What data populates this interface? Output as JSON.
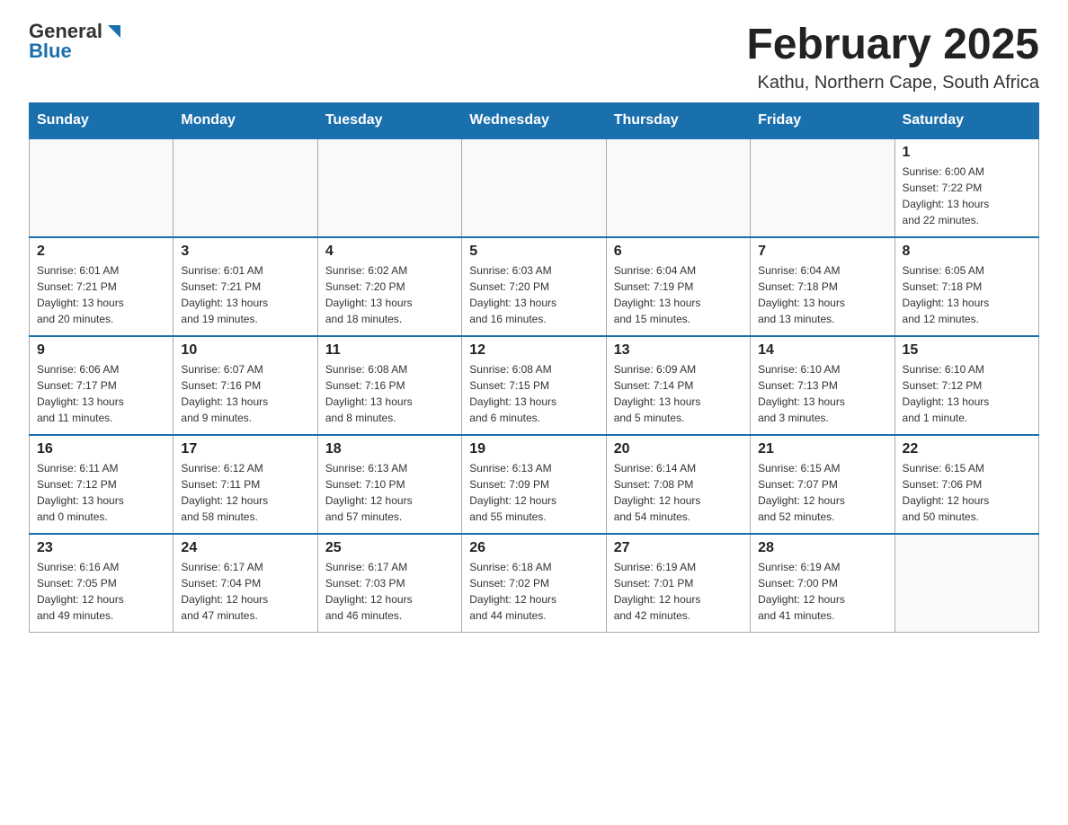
{
  "header": {
    "logo_general": "General",
    "logo_blue": "Blue",
    "month_title": "February 2025",
    "location": "Kathu, Northern Cape, South Africa"
  },
  "days_of_week": [
    "Sunday",
    "Monday",
    "Tuesday",
    "Wednesday",
    "Thursday",
    "Friday",
    "Saturday"
  ],
  "weeks": [
    {
      "days": [
        {
          "num": "",
          "info": ""
        },
        {
          "num": "",
          "info": ""
        },
        {
          "num": "",
          "info": ""
        },
        {
          "num": "",
          "info": ""
        },
        {
          "num": "",
          "info": ""
        },
        {
          "num": "",
          "info": ""
        },
        {
          "num": "1",
          "info": "Sunrise: 6:00 AM\nSunset: 7:22 PM\nDaylight: 13 hours\nand 22 minutes."
        }
      ]
    },
    {
      "days": [
        {
          "num": "2",
          "info": "Sunrise: 6:01 AM\nSunset: 7:21 PM\nDaylight: 13 hours\nand 20 minutes."
        },
        {
          "num": "3",
          "info": "Sunrise: 6:01 AM\nSunset: 7:21 PM\nDaylight: 13 hours\nand 19 minutes."
        },
        {
          "num": "4",
          "info": "Sunrise: 6:02 AM\nSunset: 7:20 PM\nDaylight: 13 hours\nand 18 minutes."
        },
        {
          "num": "5",
          "info": "Sunrise: 6:03 AM\nSunset: 7:20 PM\nDaylight: 13 hours\nand 16 minutes."
        },
        {
          "num": "6",
          "info": "Sunrise: 6:04 AM\nSunset: 7:19 PM\nDaylight: 13 hours\nand 15 minutes."
        },
        {
          "num": "7",
          "info": "Sunrise: 6:04 AM\nSunset: 7:18 PM\nDaylight: 13 hours\nand 13 minutes."
        },
        {
          "num": "8",
          "info": "Sunrise: 6:05 AM\nSunset: 7:18 PM\nDaylight: 13 hours\nand 12 minutes."
        }
      ]
    },
    {
      "days": [
        {
          "num": "9",
          "info": "Sunrise: 6:06 AM\nSunset: 7:17 PM\nDaylight: 13 hours\nand 11 minutes."
        },
        {
          "num": "10",
          "info": "Sunrise: 6:07 AM\nSunset: 7:16 PM\nDaylight: 13 hours\nand 9 minutes."
        },
        {
          "num": "11",
          "info": "Sunrise: 6:08 AM\nSunset: 7:16 PM\nDaylight: 13 hours\nand 8 minutes."
        },
        {
          "num": "12",
          "info": "Sunrise: 6:08 AM\nSunset: 7:15 PM\nDaylight: 13 hours\nand 6 minutes."
        },
        {
          "num": "13",
          "info": "Sunrise: 6:09 AM\nSunset: 7:14 PM\nDaylight: 13 hours\nand 5 minutes."
        },
        {
          "num": "14",
          "info": "Sunrise: 6:10 AM\nSunset: 7:13 PM\nDaylight: 13 hours\nand 3 minutes."
        },
        {
          "num": "15",
          "info": "Sunrise: 6:10 AM\nSunset: 7:12 PM\nDaylight: 13 hours\nand 1 minute."
        }
      ]
    },
    {
      "days": [
        {
          "num": "16",
          "info": "Sunrise: 6:11 AM\nSunset: 7:12 PM\nDaylight: 13 hours\nand 0 minutes."
        },
        {
          "num": "17",
          "info": "Sunrise: 6:12 AM\nSunset: 7:11 PM\nDaylight: 12 hours\nand 58 minutes."
        },
        {
          "num": "18",
          "info": "Sunrise: 6:13 AM\nSunset: 7:10 PM\nDaylight: 12 hours\nand 57 minutes."
        },
        {
          "num": "19",
          "info": "Sunrise: 6:13 AM\nSunset: 7:09 PM\nDaylight: 12 hours\nand 55 minutes."
        },
        {
          "num": "20",
          "info": "Sunrise: 6:14 AM\nSunset: 7:08 PM\nDaylight: 12 hours\nand 54 minutes."
        },
        {
          "num": "21",
          "info": "Sunrise: 6:15 AM\nSunset: 7:07 PM\nDaylight: 12 hours\nand 52 minutes."
        },
        {
          "num": "22",
          "info": "Sunrise: 6:15 AM\nSunset: 7:06 PM\nDaylight: 12 hours\nand 50 minutes."
        }
      ]
    },
    {
      "days": [
        {
          "num": "23",
          "info": "Sunrise: 6:16 AM\nSunset: 7:05 PM\nDaylight: 12 hours\nand 49 minutes."
        },
        {
          "num": "24",
          "info": "Sunrise: 6:17 AM\nSunset: 7:04 PM\nDaylight: 12 hours\nand 47 minutes."
        },
        {
          "num": "25",
          "info": "Sunrise: 6:17 AM\nSunset: 7:03 PM\nDaylight: 12 hours\nand 46 minutes."
        },
        {
          "num": "26",
          "info": "Sunrise: 6:18 AM\nSunset: 7:02 PM\nDaylight: 12 hours\nand 44 minutes."
        },
        {
          "num": "27",
          "info": "Sunrise: 6:19 AM\nSunset: 7:01 PM\nDaylight: 12 hours\nand 42 minutes."
        },
        {
          "num": "28",
          "info": "Sunrise: 6:19 AM\nSunset: 7:00 PM\nDaylight: 12 hours\nand 41 minutes."
        },
        {
          "num": "",
          "info": ""
        }
      ]
    }
  ]
}
